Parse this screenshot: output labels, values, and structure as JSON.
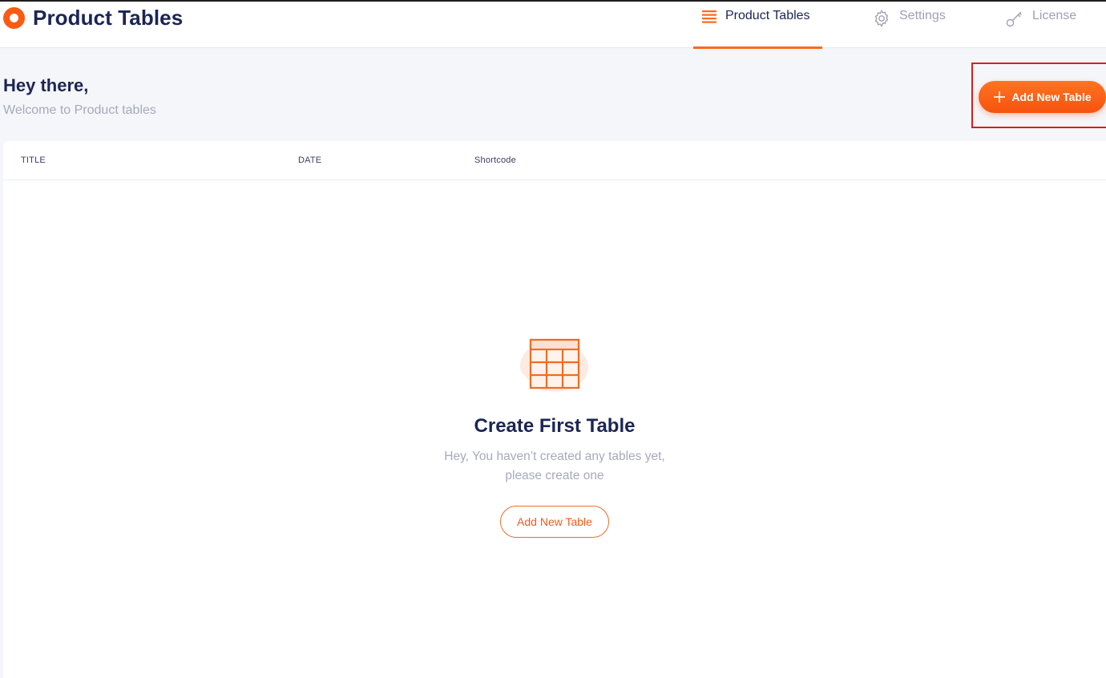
{
  "app": {
    "title": "Product Tables"
  },
  "nav": {
    "items": [
      {
        "label": "Product Tables",
        "icon": "list-icon",
        "active": true
      },
      {
        "label": "Settings",
        "icon": "gear-icon",
        "active": false
      },
      {
        "label": "License",
        "icon": "key-icon",
        "active": false
      }
    ]
  },
  "greeting": {
    "title": "Hey there,",
    "subtitle": "Welcome to Product tables"
  },
  "toolbar": {
    "add_label": "Add New Table"
  },
  "table": {
    "columns": [
      "TITLE",
      "DATE",
      "Shortcode"
    ]
  },
  "empty_state": {
    "title": "Create First Table",
    "message": "Hey, You haven’t created any tables yet, please create one",
    "button_label": "Add New Table"
  },
  "colors": {
    "accent": "#fb5a12",
    "primary_text": "#1b2556",
    "muted_text": "#a6aabb",
    "highlight_border": "#e01b1b"
  }
}
